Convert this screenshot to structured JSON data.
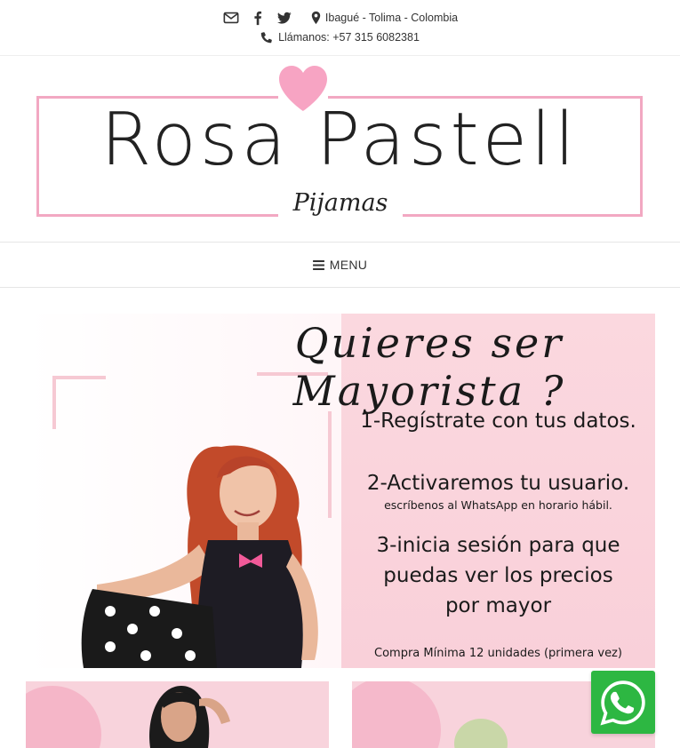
{
  "topbar": {
    "icons": [
      "envelope-icon",
      "facebook-icon",
      "twitter-icon",
      "map-marker-icon",
      "phone-icon"
    ],
    "location": "Ibagué - Tolima - Colombia",
    "phone": "Llámanos: +57 315 6082381"
  },
  "logo": {
    "name": "Rosa Pastell",
    "subtitle": "Pijamas",
    "accent_color": "#f2a8c2",
    "heart_color": "#f7a4c3"
  },
  "nav": {
    "menu_label": "MENU",
    "menu_icon": "hamburger-icon"
  },
  "banner": {
    "headline": "Quieres ser Mayorista ?",
    "step1": "1-Regístrate con tus datos.",
    "step2": "2-Activaremos tu usuario.",
    "step2_note": "escríbenos al WhatsApp en horario hábil.",
    "step3": "3-inicia sesión para que puedas ver los precios por mayor",
    "min_note": "Compra Mínima 12 unidades (primera vez)",
    "background_color": "#fbd8df"
  },
  "whatsapp": {
    "icon": "whatsapp-icon",
    "color": "#2db742"
  }
}
